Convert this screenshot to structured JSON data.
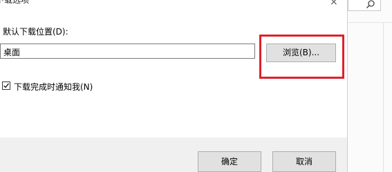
{
  "dialog": {
    "title": "下载选项",
    "close_glyph": "×"
  },
  "download_location": {
    "label": "默认下载位置(D):",
    "value": "桌面",
    "browse_label": "浏览(B)..."
  },
  "notify": {
    "label": "下载完成时通知我(N)",
    "checked": true
  },
  "footer": {
    "ok_label": "确定",
    "cancel_label": "取消"
  },
  "colors": {
    "highlight": "#e01f2a",
    "button_bg": "#e1e1e1",
    "footer_bg": "#f0f0f0"
  }
}
